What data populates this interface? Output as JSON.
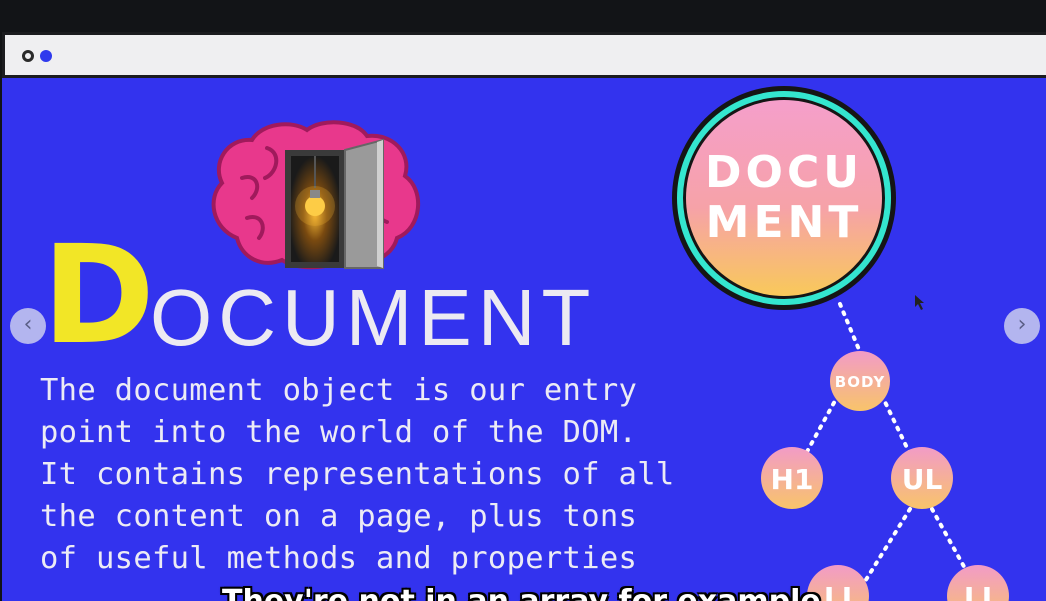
{
  "slide": {
    "title_initial": "D",
    "title_rest": "OCUMENT",
    "description_lines": [
      "The document object is our entry",
      "point into the world of the DOM.",
      "It contains representations of all",
      "the content on a page, plus tons",
      "of useful methods and properties"
    ],
    "prev_arrow": "‹",
    "next_arrow": "›",
    "colors": {
      "background": "#3333ee",
      "accent": "#f2e626",
      "text": "#eceaf2"
    }
  },
  "tree": {
    "root_label_line1": "DOCU",
    "root_label_line2": "MENT",
    "nodes": {
      "body": "BODY",
      "h1": "H1",
      "ul": "UL",
      "li_left": "LI",
      "li_right": "LI"
    }
  },
  "subtitle": "They're not in an array for example"
}
